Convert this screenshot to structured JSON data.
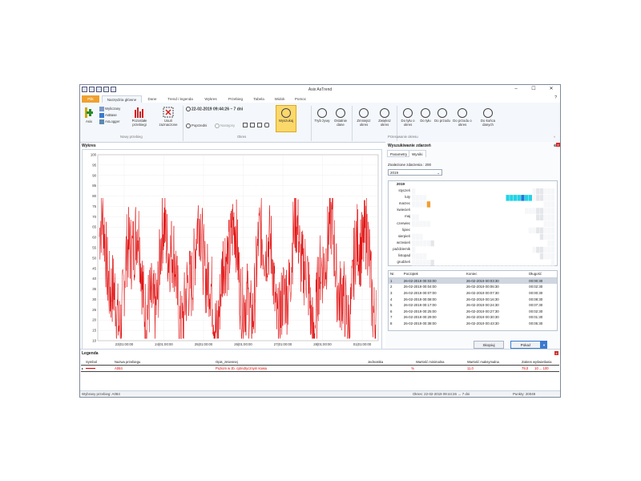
{
  "window": {
    "title": "Asix AsTrend"
  },
  "tabs": [
    {
      "label": "Plik"
    },
    {
      "label": "Narzędzia główne"
    },
    {
      "label": "Dane"
    },
    {
      "label": "Trend i legenda"
    },
    {
      "label": "Wykres"
    },
    {
      "label": "Przebieg"
    },
    {
      "label": "Tabela"
    },
    {
      "label": "Widok"
    },
    {
      "label": "Pomoc"
    }
  ],
  "ribbon": {
    "asix": "Asix",
    "wyliczany": "Wyliczany",
    "asbase": "AsBase",
    "aslogger": "AsLogger",
    "pozostale": "Pozostałe przebiegi",
    "usun": "Usuń zaznaczone",
    "group_nowy": "Nowy przebieg",
    "period_value": "22-02-2019 09:44:26 – 7 dni",
    "poprzedni": "Poprzedni",
    "nastepny": "Następny",
    "wyszukaj": "Wyszukaj",
    "group_okres": "Okres",
    "tryb": "Tryb żywy",
    "ostatnie": "Ostatnie dane",
    "zmniejsz": "Zmniejsz okres",
    "zwieksz": "Zwiększ okres",
    "do_tylu_okres": "Do tyłu o okres",
    "do_tylu": "Do tyłu",
    "do_przodu": "Do przodu",
    "do_przodu_okres": "Do przodu o okres",
    "do_konca": "Do końca danych",
    "group_przesuwanie": "Przesuwanie okresu"
  },
  "chart_panel": {
    "title": "Wykres"
  },
  "chart_data": {
    "type": "line",
    "series": [
      {
        "color": "#e00000"
      }
    ],
    "y_ticks": [
      10,
      15,
      20,
      25,
      30,
      35,
      40,
      45,
      50,
      55,
      60,
      65,
      70,
      75,
      80,
      85,
      90,
      95,
      100
    ],
    "ylim": [
      10,
      100
    ],
    "x_ticks": [
      "23|01:00:00",
      "24|01:00:00",
      "25|01:00:00",
      "26|01:00:00",
      "27|01:00:00",
      "28|01:00:00",
      "01|01:00:00"
    ],
    "grid": true
  },
  "search_panel": {
    "title": "Wyszukiwanie zdarzeń",
    "subtabs": [
      "Parametry",
      "Wyniki"
    ],
    "found": "Znalezione zdarzenia : 200",
    "year_select": "2019",
    "cal_year": "2019",
    "months": [
      "styczeń",
      "luty",
      "marzec",
      "kwiecień",
      "maj",
      "czerwiec",
      "lipiec",
      "sierpień",
      "wrzesień",
      "październik",
      "listopad",
      "grudzień"
    ]
  },
  "results": {
    "headers": [
      "Nr.",
      "Początek",
      "Koniec",
      "Długość"
    ],
    "rows": [
      [
        "1",
        "26-02-2019 00:03:00",
        "26-02-2019 00:03:30",
        "00:00:30"
      ],
      [
        "2",
        "26-02-2019 00:04:00",
        "26-02-2019 00:06:30",
        "00:02:30"
      ],
      [
        "3",
        "26-02-2019 00:07:00",
        "26-02-2019 00:07:30",
        "00:00:30"
      ],
      [
        "4",
        "26-02-2019 00:08:00",
        "26-02-2019 00:16:30",
        "00:08:30"
      ],
      [
        "5",
        "26-02-2019 00:17:00",
        "26-02-2019 00:24:30",
        "00:07:30"
      ],
      [
        "6",
        "26-02-2019 00:25:00",
        "26-02-2019 00:27:30",
        "00:02:30"
      ],
      [
        "7",
        "26-02-2019 00:29:00",
        "26-02-2019 00:30:30",
        "00:01:30"
      ],
      [
        "8",
        "26-02-2019 00:38:00",
        "26-02-2019 00:43:30",
        "00:05:30"
      ]
    ],
    "copy_btn": "Skopiuj",
    "show_btn": "Pokaż"
  },
  "legend": {
    "title": "Legenda",
    "headers": [
      "Symbol",
      "Nazwa przebiegu",
      "Opis_zmiennej",
      "Jednostka",
      "Wartość minimalna",
      "Wartość maksymalna",
      "Zakres wyświetlania"
    ],
    "row": [
      "A084",
      "Poziom w zb. cylindrycznym kowiu",
      "%",
      "11,0",
      "79,0",
      "10 ... 100"
    ]
  },
  "status": {
    "selected": "Wybrany przebieg: A084",
    "period": "Okres: 22-02-2019 09:44:26 → 7 dni",
    "points": "Punkty: 20049"
  }
}
